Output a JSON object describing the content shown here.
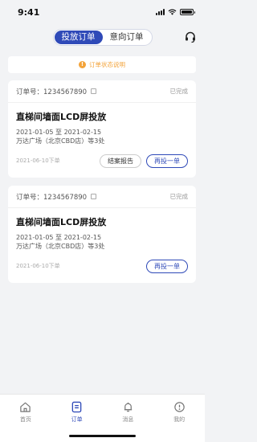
{
  "status_bar": {
    "time": "9:41"
  },
  "header": {
    "tabs": [
      {
        "label": "投放订单",
        "active": true
      },
      {
        "label": "意向订单",
        "active": false
      }
    ]
  },
  "notice": {
    "text": "订单状态说明"
  },
  "orders": [
    {
      "order_no_label": "订单号：1234567890",
      "status": "已完成",
      "title": "直梯间墙面LCD屏投放",
      "dates": "2021-01-05 至 2021-02-15",
      "location": "万达广场（北京CBD店）等3处",
      "ordered_time": "2021-06-10下单",
      "report_button": "结案报告",
      "reorder_button": "再投一单"
    },
    {
      "order_no_label": "订单号：1234567890",
      "status": "已完成",
      "title": "直梯间墙面LCD屏投放",
      "dates": "2021-01-05 至 2021-02-15",
      "location": "万达广场（北京CBD店）等3处",
      "ordered_time": "2021-06-10下单",
      "reorder_button": "再投一单"
    }
  ],
  "tabbar": {
    "items": [
      {
        "label": "首页",
        "icon": "home-icon"
      },
      {
        "label": "订单",
        "icon": "order-icon",
        "active": true
      },
      {
        "label": "消息",
        "icon": "bell-icon"
      },
      {
        "label": "我的",
        "icon": "profile-icon"
      }
    ]
  },
  "colors": {
    "accent": "#2f4ab8",
    "warning": "#f3a33a"
  }
}
